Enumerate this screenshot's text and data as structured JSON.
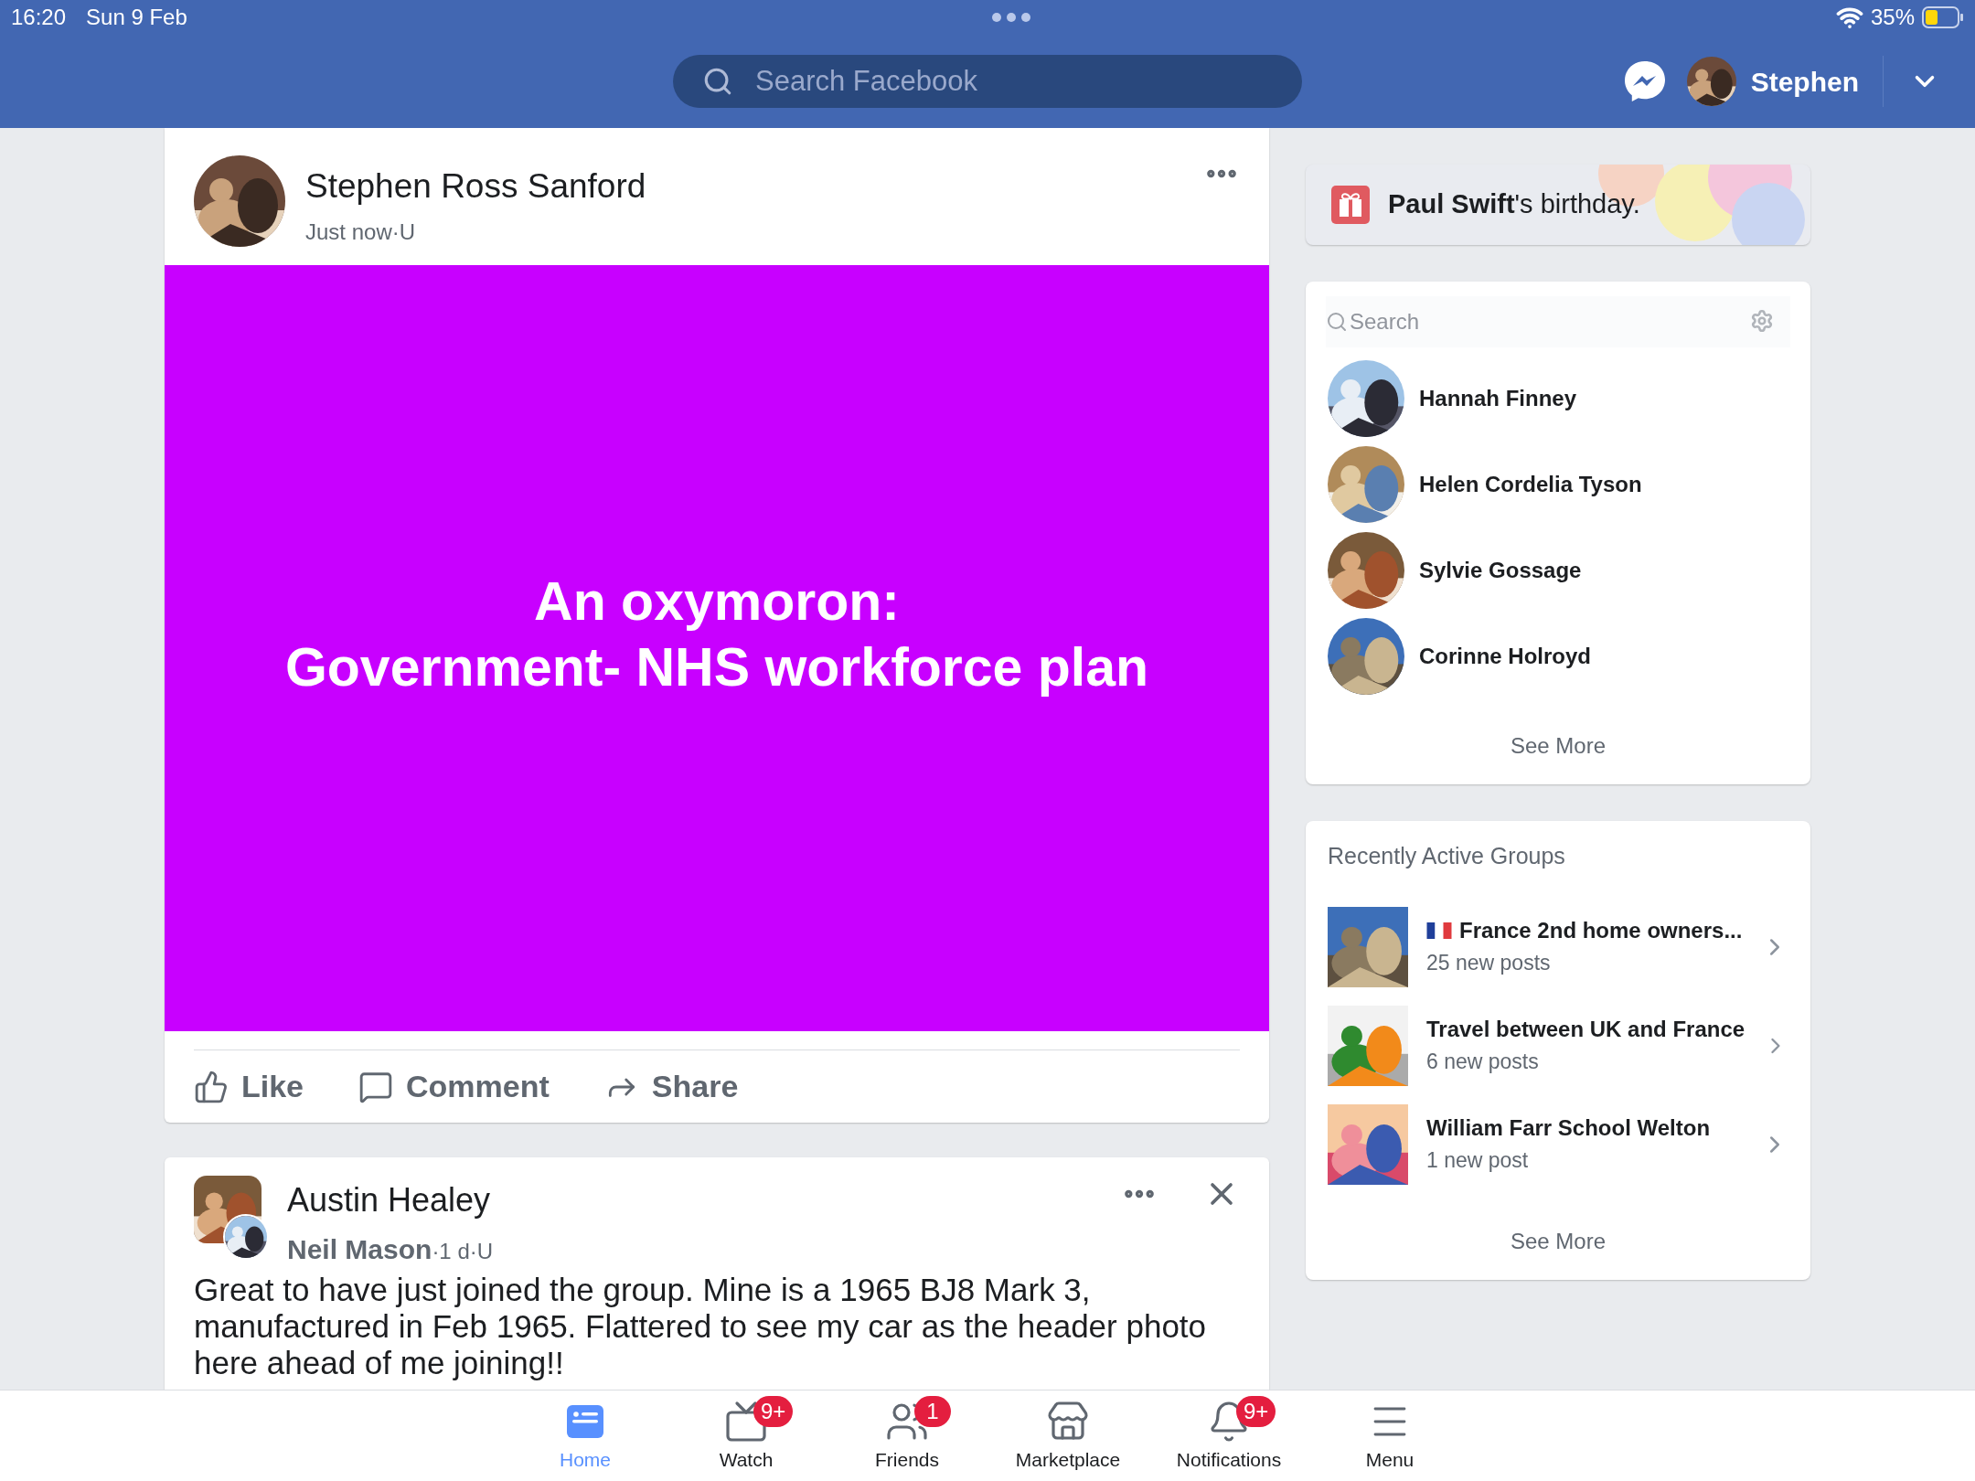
{
  "status_bar": {
    "time": "16:20",
    "date": "Sun 9 Feb",
    "battery": "35%"
  },
  "top_bar": {
    "search_placeholder": "Search Facebook",
    "user": "Stephen"
  },
  "posts": [
    {
      "author": "Stephen Ross Sanford",
      "meta": "Just now·U",
      "banner_lines": [
        "An oxymoron:",
        "Government- NHS workforce plan"
      ],
      "actions": [
        "Like",
        "Comment",
        "Share"
      ]
    },
    {
      "author": "Austin Healey",
      "poster": "Neil Mason",
      "meta": "·1 d·U",
      "text": "Great to have just joined the group. Mine is a 1965 BJ8 Mark 3, manufactured in Feb 1965. Flattered to see my car as the header photo here ahead of me joining!!",
      "closable": true
    }
  ],
  "birthday": {
    "text": "**Paul Swift**'s birthday."
  },
  "contacts": {
    "search_placeholder": "Search",
    "items": [
      {
        "name": "Hannah Finney"
      },
      {
        "name": "Helen Cordelia Tyson"
      },
      {
        "name": "Sylvie Gossage"
      },
      {
        "name": "Corinne Holroyd"
      }
    ],
    "see_more": "See More"
  },
  "groups": {
    "title": "Recently Active Groups",
    "items": [
      {
        "name": "France 2nd home owners...",
        "flag": true,
        "posts": "25 new posts"
      },
      {
        "name": "Travel between UK and France",
        "flag": false,
        "posts": "6 new posts"
      },
      {
        "name": "William Farr School Welton",
        "flag": false,
        "posts": "1 new post"
      }
    ],
    "see_more": "See More"
  },
  "bottom_nav": [
    {
      "label": "Home",
      "selected": true
    },
    {
      "label": "Watch",
      "selected": false,
      "badge": "9+"
    },
    {
      "label": "Friends",
      "selected": false,
      "badge": "1"
    },
    {
      "label": "Marketplace",
      "selected": false
    },
    {
      "label": "Notifications",
      "selected": false,
      "badge": "9+"
    },
    {
      "label": "Menu",
      "selected": false
    }
  ]
}
